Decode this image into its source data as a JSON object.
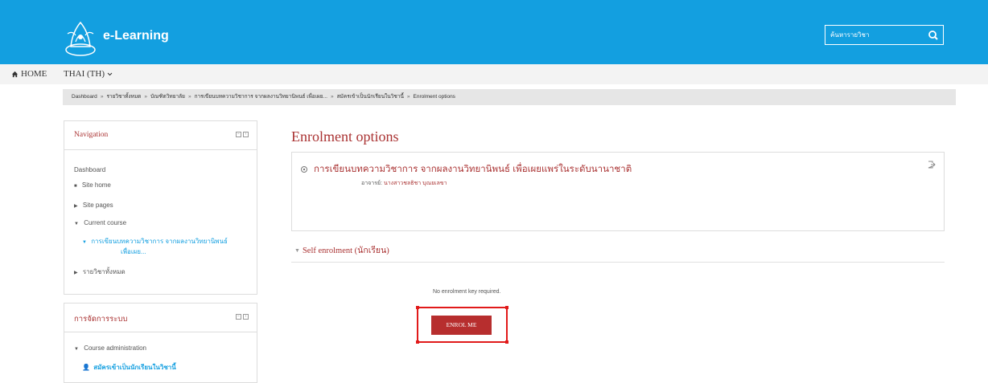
{
  "header": {
    "site_title": "e-Learning",
    "search": {
      "placeholder": "ค้นหารายวิชา"
    }
  },
  "menu": {
    "home_label": "HOME",
    "language_label": "THAI (TH)"
  },
  "breadcrumb": [
    "Dashboard",
    "รายวิชาทั้งหมด",
    "บัณฑิตวิทยาลัย",
    "การเขียนบทความวิชาการ จากผลงานวิทยานิพนธ์ เพื่อเผย...",
    "สมัครเข้าเป็นนักเรียนในวิชานี้",
    "Enrolment options"
  ],
  "navigation_block": {
    "title": "Navigation",
    "items": [
      {
        "label": "Dashboard"
      },
      {
        "label": "Site home"
      },
      {
        "label": "Site pages"
      },
      {
        "label": "Current course"
      },
      {
        "label_line1": "การเขียนบทความวิชาการ จากผลงานวิทยานิพนธ์",
        "label_line2": "เพื่อเผย..."
      },
      {
        "label": "รายวิชาทั้งหมด"
      }
    ]
  },
  "admin_block": {
    "title": "การจัดการระบบ",
    "items": [
      {
        "label": "Course administration"
      },
      {
        "label": "สมัครเข้าเป็นนักเรียนในวิชานี้"
      }
    ]
  },
  "main": {
    "page_title": "Enrolment options",
    "course": {
      "name": "การเขียนบทความวิชาการ จากผลงานวิทยานิพนธ์ เพื่อเผยแพร่ในระดับนานาชาติ",
      "teacher_label": "อาจารย์:",
      "teacher_name": "นางสาวชลธิชา บุณยเลขา"
    },
    "section": {
      "title": "Self enrolment (นักเรียน)",
      "no_key_text": "No enrolment key required.",
      "enrol_button": "ENROL ME"
    }
  },
  "colors": {
    "header_bg": "#139fe0",
    "accent_red": "#a33333",
    "button_red": "#b72e2e",
    "highlight_red": "#e11a1a"
  }
}
